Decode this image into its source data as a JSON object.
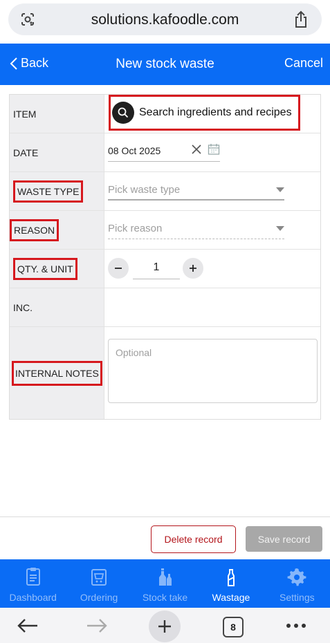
{
  "browser": {
    "url": "solutions.kafoodle.com",
    "tabs_count": "8"
  },
  "header": {
    "back_label": "Back",
    "title": "New stock waste",
    "cancel_label": "Cancel"
  },
  "form": {
    "item_label": "ITEM",
    "item_search_placeholder": "Search ingredients and recipes",
    "date_label": "DATE",
    "date_value": "08 Oct 2025",
    "waste_type_label": "WASTE TYPE",
    "waste_type_placeholder": "Pick waste type",
    "reason_label": "REASON",
    "reason_placeholder": "Pick reason",
    "qty_label": "QTY. & UNIT",
    "qty_value": "1",
    "inc_label": "INC.",
    "notes_label": "INTERNAL NOTES",
    "notes_placeholder": "Optional"
  },
  "actions": {
    "delete_label": "Delete record",
    "save_label": "Save record"
  },
  "nav": {
    "items": [
      {
        "label": "Dashboard",
        "icon": "clipboard-icon"
      },
      {
        "label": "Ordering",
        "icon": "cart-icon"
      },
      {
        "label": "Stock take",
        "icon": "bottles-icon"
      },
      {
        "label": "Wastage",
        "icon": "bottle-icon",
        "active": true
      },
      {
        "label": "Settings",
        "icon": "gear-icon"
      }
    ]
  },
  "colors": {
    "brand": "#0a6cf5",
    "highlight": "#d6181e",
    "delete": "#b3151b"
  }
}
